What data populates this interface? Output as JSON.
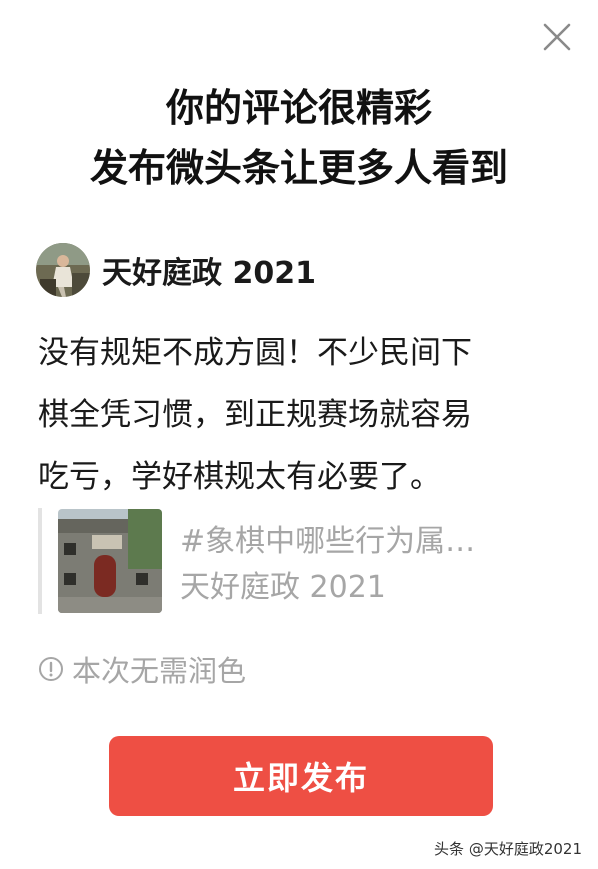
{
  "close": {
    "icon": "close-icon"
  },
  "headline": {
    "line1": "你的评论很精彩",
    "line2": "发布微头条让更多人看到"
  },
  "author": {
    "name": "天好庭政 2021",
    "avatar_icon": "avatar"
  },
  "comment": {
    "lines": [
      "没有规矩不成方圆！不少民间下",
      "棋全凭习惯，到正规赛场就容易",
      "吃亏，学好棋规太有必要了。"
    ]
  },
  "quoted_article": {
    "title": "#象棋中哪些行为属…",
    "author": "天好庭政 2021"
  },
  "note": {
    "icon": "info-icon",
    "text": "本次无需润色"
  },
  "publish_button": {
    "label": "立即发布"
  },
  "watermark": {
    "text": "头条 @天好庭政2021"
  },
  "colors": {
    "accent": "#ee4f44",
    "muted_text": "#a6a6a6",
    "primary_text": "#1a1a1a"
  }
}
